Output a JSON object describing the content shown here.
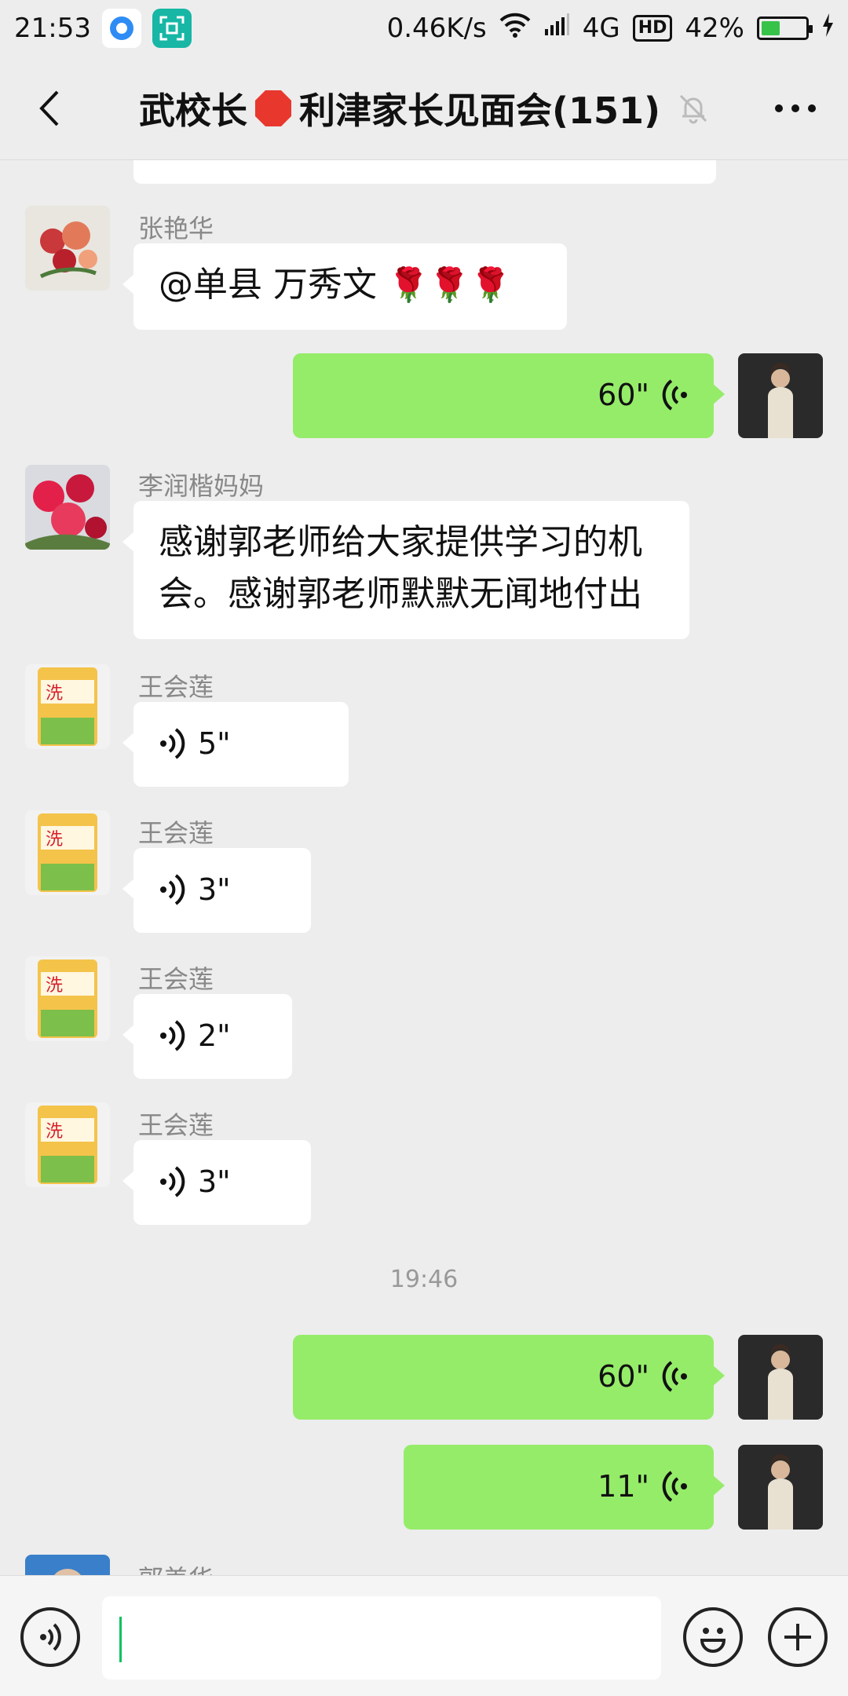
{
  "status_bar": {
    "time": "21:53",
    "net_speed": "0.46K/s",
    "network": "4G",
    "hd": "HD",
    "battery": "42%",
    "battery_level": 0.42
  },
  "header": {
    "title_part1": "武校长",
    "title_part2": "利津家长见面会(151)",
    "back_icon": "chevron-left-icon",
    "mute_icon": "bell-muted-icon",
    "more_icon": "more-icon"
  },
  "messages": [
    {
      "sender": "张艳华",
      "text": "@单县  万秀文 ",
      "emoji": "🌹🌹🌹"
    },
    {
      "self": true,
      "duration": "60\""
    },
    {
      "sender": "李润楷妈妈",
      "text_line1": "感谢郭老师给大家提供学习的机",
      "text_line2": "会。感谢郭老师默默无闻地付出"
    },
    {
      "sender": "王会莲",
      "duration": "5\""
    },
    {
      "sender": "王会莲",
      "duration": "3\""
    },
    {
      "sender": "王会莲",
      "duration": "2\""
    },
    {
      "sender": "王会莲",
      "duration": "3\""
    },
    {
      "timestamp": "19:46"
    },
    {
      "self": true,
      "duration": "60\""
    },
    {
      "self": true,
      "duration": "11\""
    },
    {
      "sender": "郭美华"
    }
  ],
  "input_bar": {
    "voice_icon": "voice-mode-icon",
    "emoji_icon": "emoji-icon",
    "plus_icon": "plus-icon",
    "value": ""
  },
  "colors": {
    "background": "#ededed",
    "self_bubble": "#95ec69",
    "other_bubble": "#ffffff",
    "cursor": "#07c160"
  }
}
